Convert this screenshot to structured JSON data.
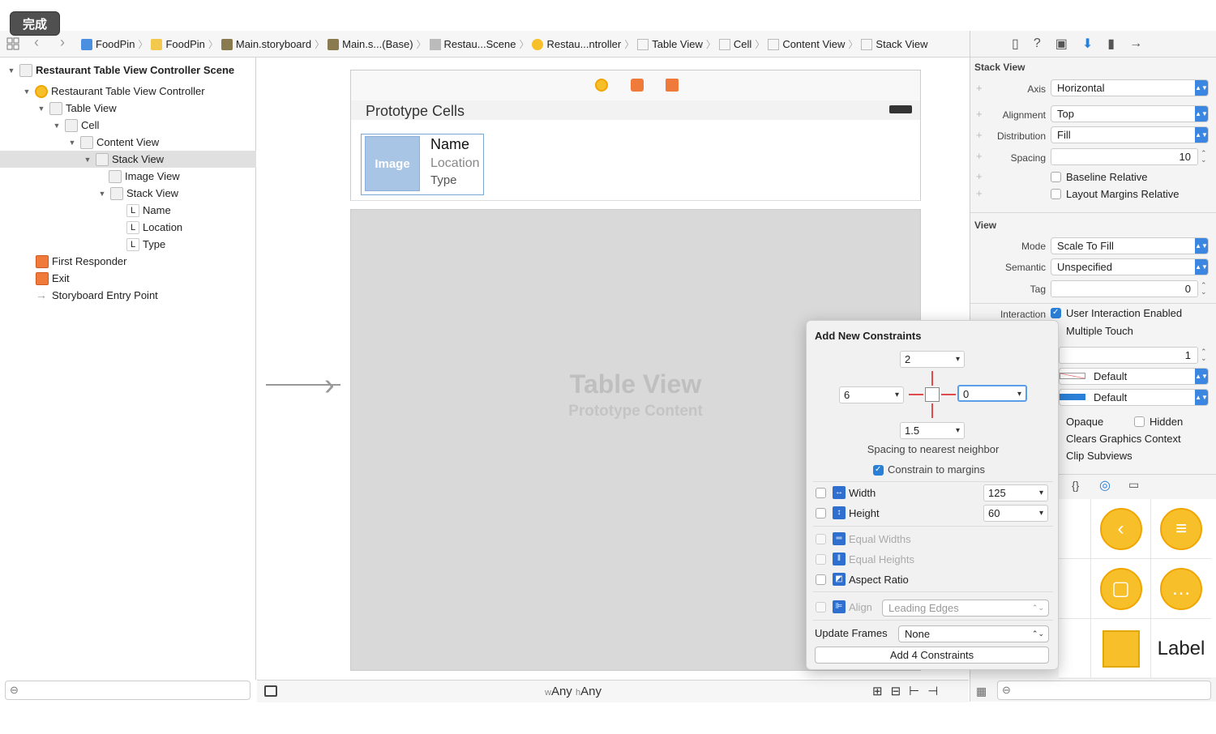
{
  "done_button": "完成",
  "breadcrumbs": [
    "FoodPin",
    "FoodPin",
    "Main.storyboard",
    "Main.s...(Base)",
    "Restau...Scene",
    "Restau...ntroller",
    "Table View",
    "Cell",
    "Content View",
    "Stack View"
  ],
  "outline": {
    "items": [
      {
        "label": "Restaurant Table View Controller Scene",
        "bold": true
      },
      {
        "label": "Restaurant Table View Controller"
      },
      {
        "label": "Table View"
      },
      {
        "label": "Cell"
      },
      {
        "label": "Content View"
      },
      {
        "label": "Stack View",
        "selected": true
      },
      {
        "label": "Image View"
      },
      {
        "label": "Stack View"
      },
      {
        "label": "Name"
      },
      {
        "label": "Location"
      },
      {
        "label": "Type"
      },
      {
        "label": "First Responder"
      },
      {
        "label": "Exit"
      },
      {
        "label": "Storyboard Entry Point"
      }
    ]
  },
  "canvas": {
    "prototype_header": "Prototype Cells",
    "cell_image": "Image",
    "cell_name": "Name",
    "cell_location": "Location",
    "cell_type": "Type",
    "table_title": "Table View",
    "table_subtitle": "Prototype Content",
    "size_w": "Any",
    "size_h": "Any",
    "size_w_prefix": "w",
    "size_h_prefix": "h"
  },
  "inspector": {
    "stack_section": "Stack View",
    "axis_label": "Axis",
    "axis_value": "Horizontal",
    "alignment_label": "Alignment",
    "alignment_value": "Top",
    "distribution_label": "Distribution",
    "distribution_value": "Fill",
    "spacing_label": "Spacing",
    "spacing_value": "10",
    "baseline_relative": "Baseline Relative",
    "layout_margins_relative": "Layout Margins Relative",
    "view_section": "View",
    "mode_label": "Mode",
    "mode_value": "Scale To Fill",
    "semantic_label": "Semantic",
    "semantic_value": "Unspecified",
    "tag_label": "Tag",
    "tag_value": "0",
    "interaction_label": "Interaction",
    "user_interaction": "User Interaction Enabled",
    "multiple_touch": "Multiple Touch",
    "alpha_value": "1",
    "background_value": "Default",
    "tint_value": "Default",
    "opaque": "Opaque",
    "hidden": "Hidden",
    "clears_graphics": "Clears Graphics Context",
    "clip_subviews": "Clip Subviews"
  },
  "library": {
    "label_item": "Label"
  },
  "constraints": {
    "title": "Add New Constraints",
    "top": "2",
    "left": "6",
    "right": "0",
    "bottom": "1.5",
    "spacing_caption": "Spacing to nearest neighbor",
    "constrain_margins": "Constrain to margins",
    "width_label": "Width",
    "width_value": "125",
    "height_label": "Height",
    "height_value": "60",
    "equal_widths": "Equal Widths",
    "equal_heights": "Equal Heights",
    "aspect_ratio": "Aspect Ratio",
    "align_label": "Align",
    "align_value": "Leading Edges",
    "update_frames_label": "Update Frames",
    "update_frames_value": "None",
    "add_button": "Add 4 Constraints"
  },
  "colors": {
    "accent": "#2a7fd6",
    "constraint_red": "#e24b4b",
    "object_yellow": "#f7c02b"
  }
}
